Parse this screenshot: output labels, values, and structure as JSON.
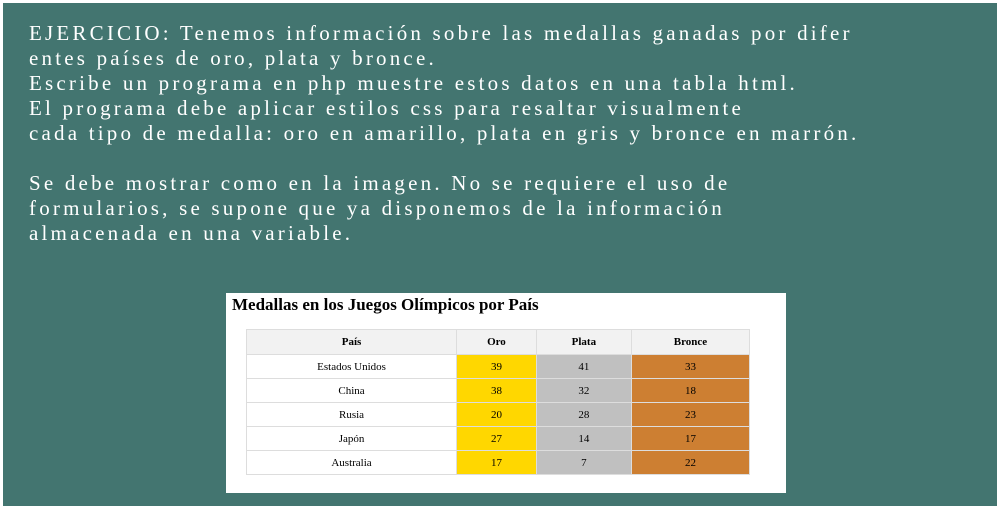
{
  "exercise": {
    "lines": [
      "EJERCICIO: Tenemos información sobre las medallas ganadas por difer",
      "entes países de oro, plata y bronce.",
      "Escribe un programa en php muestre estos datos en una tabla html.",
      "El programa debe aplicar estilos css para resaltar visualmente",
      "cada tipo de medalla: oro en amarillo, plata en gris y bronce en marrón.",
      "Se debe mostrar como en la imagen. No se requiere el uso de",
      "formularios, se supone que ya disponemos de la información",
      "almacenada en una variable."
    ]
  },
  "table_panel": {
    "title": "Medallas en los Juegos Olímpicos por País",
    "headers": [
      "País",
      "Oro",
      "Plata",
      "Bronce"
    ],
    "rows": [
      [
        "Estados Unidos",
        "39",
        "41",
        "33"
      ],
      [
        "China",
        "38",
        "32",
        "18"
      ],
      [
        "Rusia",
        "20",
        "28",
        "23"
      ],
      [
        "Japón",
        "27",
        "14",
        "17"
      ],
      [
        "Australia",
        "17",
        "7",
        "22"
      ]
    ]
  },
  "colors": {
    "background": "#437570",
    "gold": "#ffd700",
    "silver": "#c0c0c0",
    "bronze": "#cd7f32",
    "header": "#f2f2f2"
  }
}
